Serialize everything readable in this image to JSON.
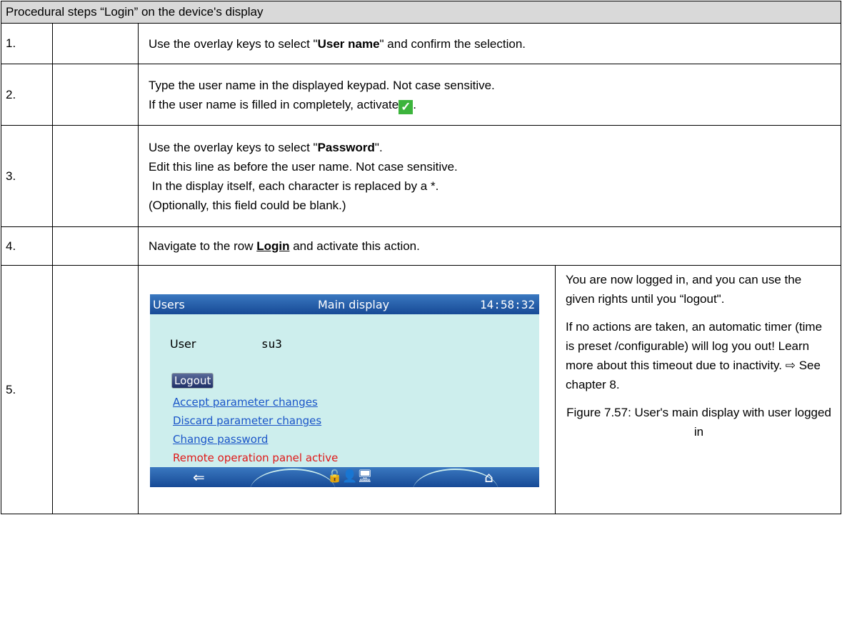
{
  "header": {
    "title_prefix": "Procedural steps ",
    "title_quoted": "Login",
    "title_suffix": " on the device's display"
  },
  "steps": [
    {
      "num": "1.",
      "parts": [
        "Use the overlay keys to select \"",
        "User name",
        "\" and confirm the selection."
      ]
    },
    {
      "num": "2.",
      "line1": "Type the user name in the displayed keypad. Not case sensitive.",
      "line2": "If the user name is filled in completely, activate",
      "line2_end": "."
    },
    {
      "num": "3.",
      "line1_a": "Use the overlay keys to select \"",
      "line1_b": "Password",
      "line1_c": "\".",
      "line2": "Edit this line as before the user name. Not case sensitive.",
      "line3": " In the display itself, each character is replaced by a *.",
      "line4": "(Optionally, this field could be blank.)"
    },
    {
      "num": "4.",
      "a": "Navigate to the row ",
      "b": "Login",
      "c": " and activate this action."
    },
    {
      "num": "5."
    }
  ],
  "screen": {
    "title_left": "Users",
    "title_mid": "Main display",
    "clock": "14:58:32",
    "user_label": "User",
    "user_value": "su3",
    "logout": "Logout",
    "links": [
      "Accept parameter changes",
      "Discard parameter changes",
      "Change password"
    ],
    "warning": "Remote operation panel active",
    "back_icon": "⇐",
    "home_icon": "⌂",
    "status_icons": "🔓👤🖥"
  },
  "side": {
    "p1": "You are now logged in, and you can use the given rights until you “logout\".",
    "p2": "If no actions are taken, an automatic timer (time is preset /configurable) will log you out! Learn more about this timeout due to inactivity. ⇨ See chapter 8.",
    "caption": "Figure 7.57: User's main display with user logged in"
  },
  "colors": {
    "check": "#3cb43c",
    "link": "#1a55c8",
    "warning": "#e01818",
    "screen_bg": "#cdeeed",
    "bar": "#174a96"
  }
}
